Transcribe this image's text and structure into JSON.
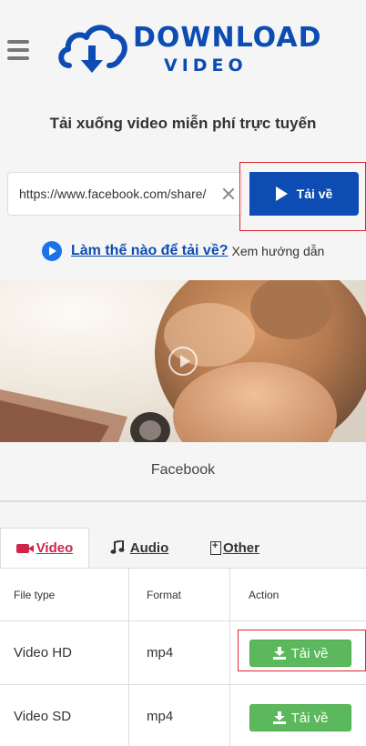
{
  "header": {
    "logo_line1": "DOWNLOAD",
    "logo_line2": "VIDEO",
    "menu_icon": "hamburger-menu-icon",
    "brand_color": "#0d4cb3"
  },
  "tagline": "Tải xuống video miễn phí trực tuyến",
  "search": {
    "value": "https://www.facebook.com/share/",
    "clear_icon": "close-icon",
    "button_label": "Tải về"
  },
  "howto": {
    "link_text": "Làm thế nào để tải về?",
    "rest_text": "Xem hướng dẫn"
  },
  "preview": {
    "source": "Facebook"
  },
  "tabs": [
    {
      "label": "Video",
      "icon": "video-camera-icon",
      "active": true
    },
    {
      "label": "Audio",
      "icon": "music-note-icon",
      "active": false
    },
    {
      "label": "Other",
      "icon": "file-plus-icon",
      "active": false
    }
  ],
  "table": {
    "headers": [
      "File type",
      "Format",
      "Action"
    ],
    "rows": [
      {
        "type": "Video HD",
        "format": "mp4",
        "action": "Tải về"
      },
      {
        "type": "Video SD",
        "format": "mp4",
        "action": "Tải về"
      }
    ]
  },
  "colors": {
    "accent_red": "#e0242f",
    "tab_active": "#d0244a",
    "download_green": "#5cb85c"
  }
}
